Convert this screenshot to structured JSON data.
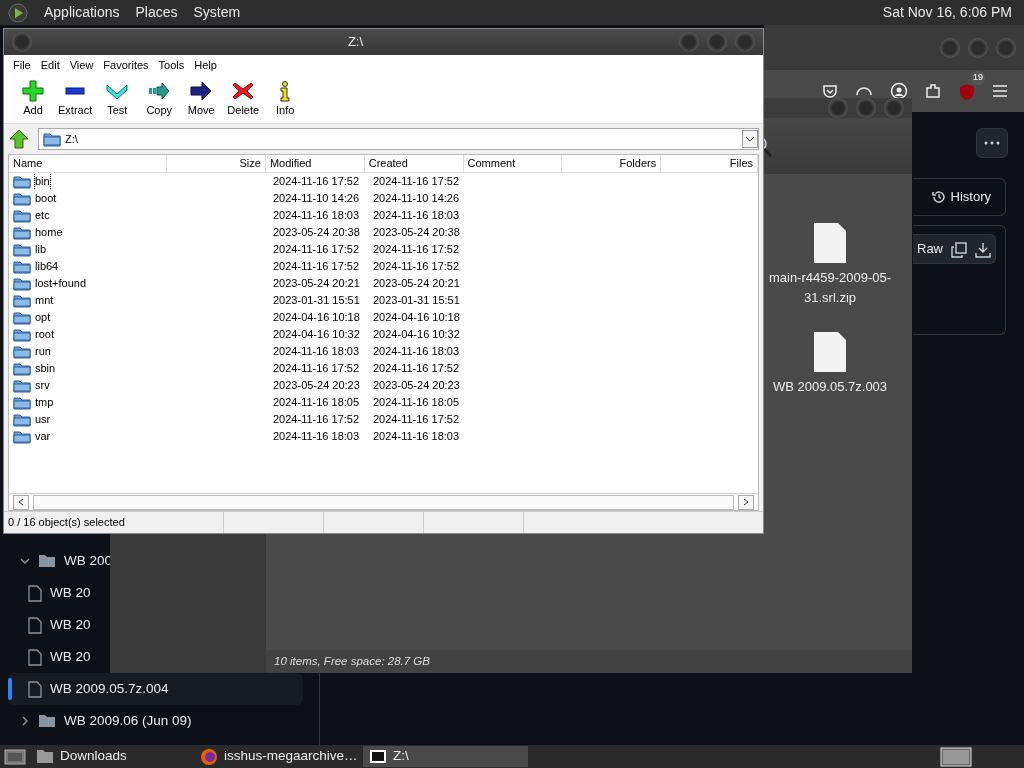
{
  "top_panel": {
    "menus": [
      "Applications",
      "Places",
      "System"
    ],
    "clock": "Sat Nov 16, 6:06 PM"
  },
  "browser": {
    "notification_badge": "19",
    "history_button": "History",
    "raw_button": "Raw",
    "tree": [
      {
        "label": "WB 200",
        "kind": "folder",
        "expanded": true,
        "selected": false,
        "children": [
          {
            "label": "WB 20",
            "kind": "file",
            "selected": false
          },
          {
            "label": "WB 20",
            "kind": "file",
            "selected": false
          },
          {
            "label": "WB 20",
            "kind": "file",
            "selected": false
          },
          {
            "label": "WB 2009.05.7z.004",
            "kind": "file",
            "selected": true
          }
        ]
      },
      {
        "label": "WB 2009.06 (Jun 09)",
        "kind": "folder",
        "expanded": false,
        "selected": false
      }
    ]
  },
  "file_manager": {
    "files": [
      {
        "name": "main-r4459-2009-05-31.srl.zip"
      },
      {
        "name": "WB 2009.05.7z.003"
      }
    ],
    "status": "10 items, Free space: 28.7 GB"
  },
  "archiver": {
    "title": "Z:\\",
    "menu": [
      "File",
      "Edit",
      "View",
      "Favorites",
      "Tools",
      "Help"
    ],
    "toolbar": [
      {
        "label": "Add",
        "kind": "add"
      },
      {
        "label": "Extract",
        "kind": "extract"
      },
      {
        "label": "Test",
        "kind": "test"
      },
      {
        "label": "Copy",
        "kind": "copy"
      },
      {
        "label": "Move",
        "kind": "move"
      },
      {
        "label": "Delete",
        "kind": "delete"
      },
      {
        "label": "Info",
        "kind": "info"
      }
    ],
    "path": "Z:\\",
    "columns": [
      "Name",
      "Size",
      "Modified",
      "Created",
      "Comment",
      "Folders",
      "Files"
    ],
    "rows": [
      {
        "name": "bin",
        "modified": "2024-11-16 17:52",
        "created": "2024-11-16 17:52",
        "focused": true
      },
      {
        "name": "boot",
        "modified": "2024-11-10 14:26",
        "created": "2024-11-10 14:26",
        "focused": false
      },
      {
        "name": "etc",
        "modified": "2024-11-16 18:03",
        "created": "2024-11-16 18:03",
        "focused": false
      },
      {
        "name": "home",
        "modified": "2023-05-24 20:38",
        "created": "2023-05-24 20:38",
        "focused": false
      },
      {
        "name": "lib",
        "modified": "2024-11-16 17:52",
        "created": "2024-11-16 17:52",
        "focused": false
      },
      {
        "name": "lib64",
        "modified": "2024-11-16 17:52",
        "created": "2024-11-16 17:52",
        "focused": false
      },
      {
        "name": "lost+found",
        "modified": "2023-05-24 20:21",
        "created": "2023-05-24 20:21",
        "focused": false
      },
      {
        "name": "mnt",
        "modified": "2023-01-31 15:51",
        "created": "2023-01-31 15:51",
        "focused": false
      },
      {
        "name": "opt",
        "modified": "2024-04-16 10:18",
        "created": "2024-04-16 10:18",
        "focused": false
      },
      {
        "name": "root",
        "modified": "2024-04-16 10:32",
        "created": "2024-04-16 10:32",
        "focused": false
      },
      {
        "name": "run",
        "modified": "2024-11-16 18:03",
        "created": "2024-11-16 18:03",
        "focused": false
      },
      {
        "name": "sbin",
        "modified": "2024-11-16 17:52",
        "created": "2024-11-16 17:52",
        "focused": false
      },
      {
        "name": "srv",
        "modified": "2023-05-24 20:23",
        "created": "2023-05-24 20:23",
        "focused": false
      },
      {
        "name": "tmp",
        "modified": "2024-11-16 18:05",
        "created": "2024-11-16 18:05",
        "focused": false
      },
      {
        "name": "usr",
        "modified": "2024-11-16 17:52",
        "created": "2024-11-16 17:52",
        "focused": false
      },
      {
        "name": "var",
        "modified": "2024-11-16 18:03",
        "created": "2024-11-16 18:03",
        "focused": false
      }
    ],
    "status": "0 / 16 object(s) selected"
  },
  "taskbar": {
    "items": [
      {
        "label": "Downloads",
        "kind": "folder",
        "selected": false
      },
      {
        "label": "isshus-megaarchive…",
        "kind": "browser",
        "selected": false
      },
      {
        "label": "Z:\\",
        "kind": "archiver",
        "selected": true
      }
    ]
  }
}
